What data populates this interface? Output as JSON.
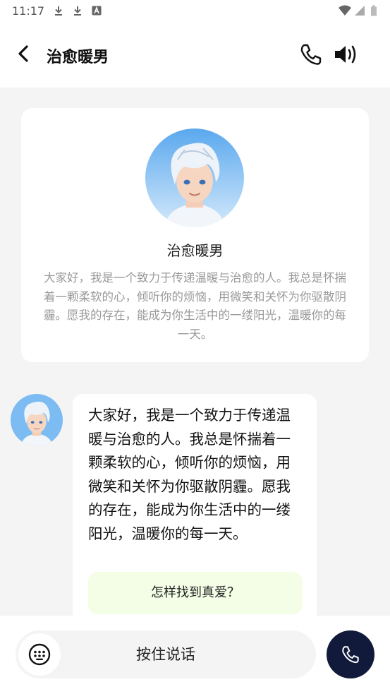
{
  "status_bar": {
    "time": "11:17"
  },
  "header": {
    "title": "治愈暖男"
  },
  "profile": {
    "name": "治愈暖男",
    "bio": "大家好，我是一个致力于传递温暖与治愈的人。我总是怀揣着一颗柔软的心，倾听你的烦恼，用微笑和关怀为你驱散阴霾。愿我的存在，能成为你生活中的一缕阳光，温暖你的每一天。"
  },
  "chat": {
    "messages": [
      {
        "text": "大家好，我是一个致力于传递温暖与治愈的人。我总是怀揣着一颗柔软的心，倾听你的烦恼，用微笑和关怀为你驱散阴霾。愿我的存在，能成为你生活中的一缕阳光，温暖你的每一天。",
        "suggestion": "怎样找到真爱？"
      }
    ]
  },
  "input": {
    "hold_label": "按住说话"
  },
  "colors": {
    "accent": "#111a3a",
    "chip_bg": "#f4fde6",
    "page_bg": "#f4f4f4"
  }
}
